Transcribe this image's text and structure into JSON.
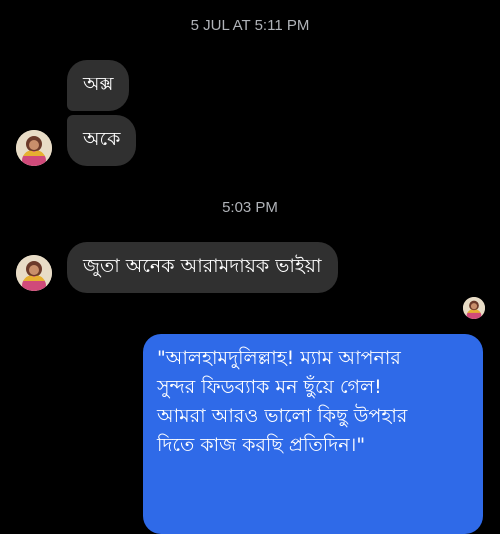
{
  "chat": {
    "timestamp_1": "5 JUL AT 5:11 PM",
    "received_1": "অক্স",
    "received_2": "অকে",
    "timestamp_2": "5:03 PM",
    "received_3": "জুতা অনেক আরামদায়ক ভাইয়া",
    "sent_lines": [
      "\"আলহামদুলিল্লাহ! ম্যাম আপনার",
      "সুন্দর ফিডব্যাক মন ছুঁয়ে গেল!",
      "আমরা আরও ভালো কিছু উপহার",
      "দিতে কাজ করছি প্রতিদিন।\""
    ]
  },
  "colors": {
    "background": "#000000",
    "received_bubble": "#303030",
    "sent_bubble": "#2f6ae8",
    "timestamp_text": "#b0b3b8"
  },
  "icons": {
    "avatar": "contact-avatar-icon",
    "seen_avatar": "seen-avatar-icon"
  }
}
